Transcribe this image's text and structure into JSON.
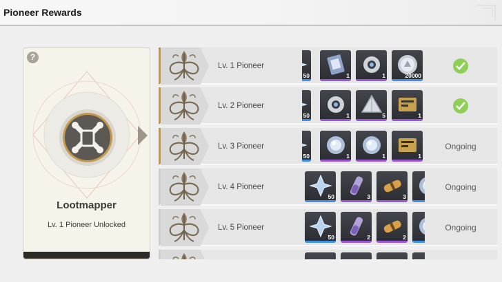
{
  "header": {
    "title": "Pioneer Rewards"
  },
  "card": {
    "help": "?",
    "name": "Lootmapper",
    "subtitle": "Lv. 1 Pioneer Unlocked"
  },
  "colors": {
    "accent_gold": "#b8985a",
    "check_green": "#8fcf55",
    "rarity_purple": "#9b55d8",
    "rarity_blue": "#3e8fe6"
  },
  "rows": [
    {
      "label": "Lv. 1 Pioneer",
      "status_type": "claimed",
      "status_text": "",
      "items": [
        {
          "icon": "crystal-icon",
          "qty": "50",
          "rarity": "blue"
        },
        {
          "icon": "ticket-icon",
          "qty": "1",
          "rarity": "purple"
        },
        {
          "icon": "gear-icon",
          "qty": "1",
          "rarity": "purple"
        },
        {
          "icon": "coin-icon",
          "qty": "20000",
          "rarity": "blue"
        }
      ]
    },
    {
      "label": "Lv. 2 Pioneer",
      "status_type": "claimed",
      "status_text": "",
      "items": [
        {
          "icon": "crystal-icon",
          "qty": "50",
          "rarity": "blue"
        },
        {
          "icon": "gear-icon",
          "qty": "1",
          "rarity": "purple"
        },
        {
          "icon": "pyramid-icon",
          "qty": "5",
          "rarity": "purple"
        },
        {
          "icon": "card-icon",
          "qty": "1",
          "rarity": "purple"
        }
      ]
    },
    {
      "label": "Lv. 3 Pioneer",
      "status_type": "text",
      "status_text": "Ongoing",
      "items": [
        {
          "icon": "crystal-icon",
          "qty": "50",
          "rarity": "blue"
        },
        {
          "icon": "orb-icon",
          "qty": "1",
          "rarity": "purple"
        },
        {
          "icon": "orb-icon",
          "qty": "1",
          "rarity": "purple"
        },
        {
          "icon": "card-icon",
          "qty": "1",
          "rarity": "purple"
        }
      ]
    },
    {
      "label": "Lv. 4 Pioneer",
      "status_type": "text",
      "status_text": "Ongoing",
      "items": [
        {
          "icon": "crystal-icon",
          "qty": "50",
          "rarity": "blue"
        },
        {
          "icon": "vial-icon",
          "qty": "3",
          "rarity": "purple"
        },
        {
          "icon": "capsule-icon",
          "qty": "3",
          "rarity": "purple"
        },
        {
          "icon": "orb-icon",
          "qty": "",
          "rarity": "blue"
        }
      ]
    },
    {
      "label": "Lv. 5 Pioneer",
      "status_type": "text",
      "status_text": "Ongoing",
      "items": [
        {
          "icon": "crystal-icon",
          "qty": "50",
          "rarity": "blue"
        },
        {
          "icon": "vial-icon",
          "qty": "2",
          "rarity": "purple"
        },
        {
          "icon": "capsule-icon",
          "qty": "2",
          "rarity": "purple"
        },
        {
          "icon": "orb-icon",
          "qty": "",
          "rarity": "blue"
        }
      ]
    },
    {
      "label": "",
      "status_type": "text",
      "status_text": "",
      "items": [
        {
          "icon": "crystal-icon",
          "qty": "",
          "rarity": "blue"
        },
        {
          "icon": "vial-icon",
          "qty": "",
          "rarity": "purple"
        },
        {
          "icon": "capsule-icon",
          "qty": "",
          "rarity": "purple"
        },
        {
          "icon": "orb-icon",
          "qty": "",
          "rarity": "blue"
        }
      ]
    }
  ]
}
